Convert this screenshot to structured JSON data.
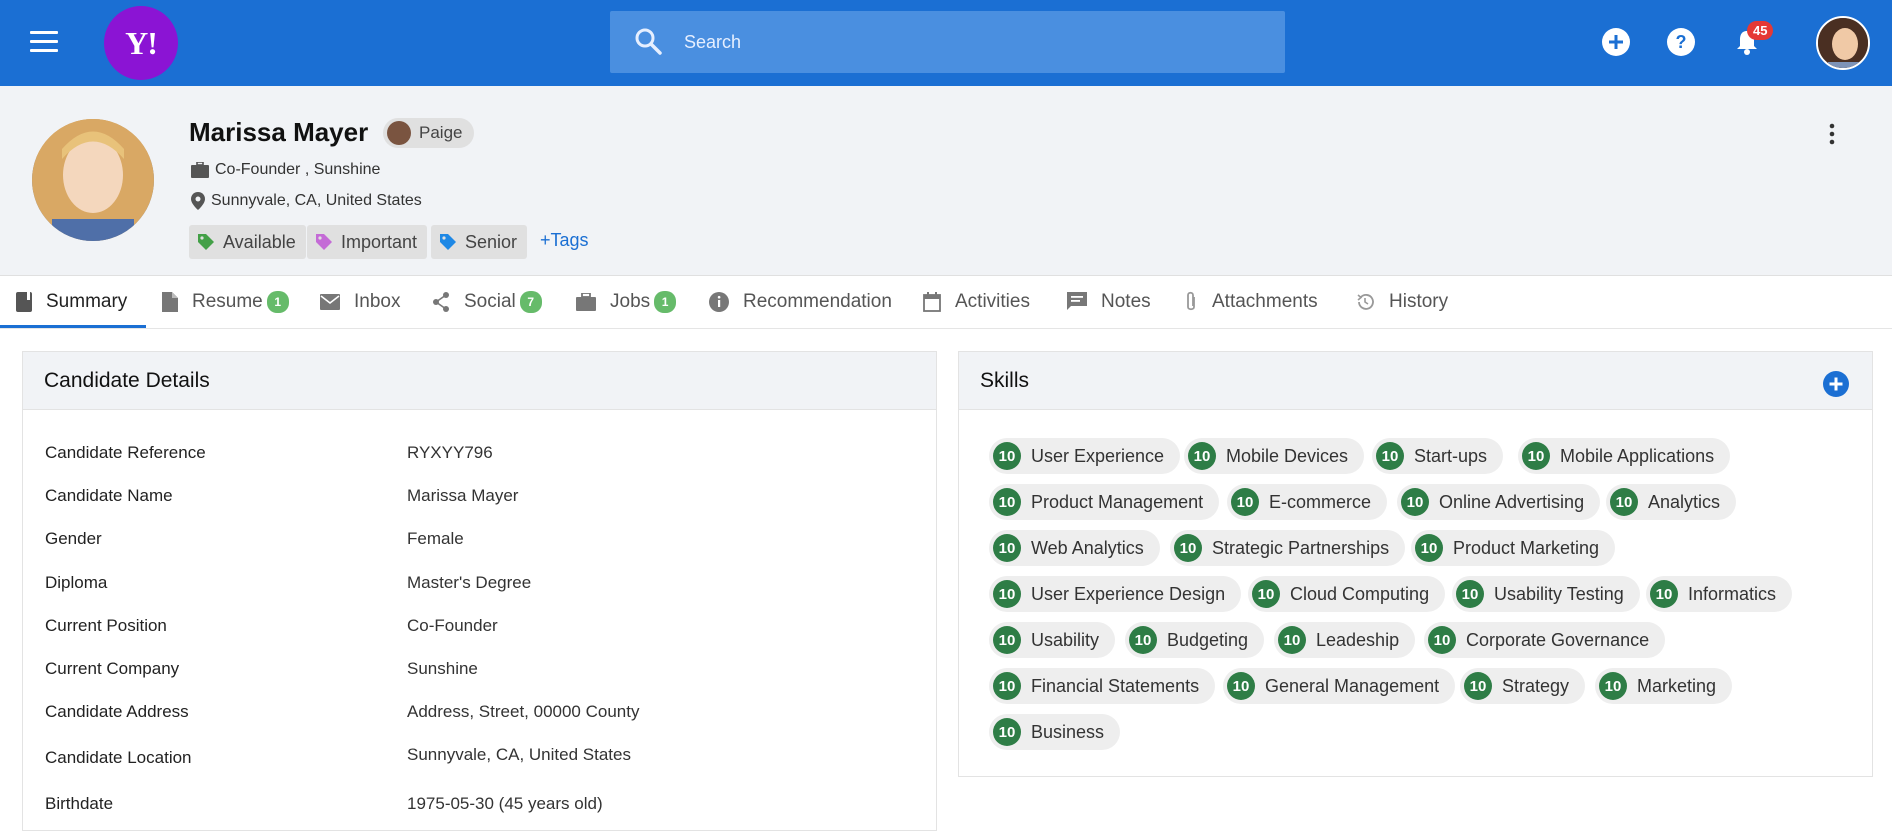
{
  "header": {
    "logo_text": "Y!",
    "search_placeholder": "Search",
    "notification_count": "45"
  },
  "profile": {
    "name": "Marissa Mayer",
    "owner": "Paige",
    "position_line": "Co-Founder , Sunshine",
    "location_line": "Sunnyvale, CA, United States",
    "tags": [
      {
        "label": "Available",
        "color": "#43a047"
      },
      {
        "label": "Important",
        "color": "#c46bd6"
      },
      {
        "label": "Senior",
        "color": "#1e88e5"
      }
    ],
    "add_tags_label": "+Tags"
  },
  "tabs": [
    {
      "label": "Summary",
      "icon": "book-icon"
    },
    {
      "label": "Resume",
      "icon": "document-icon",
      "count": "1"
    },
    {
      "label": "Inbox",
      "icon": "mail-icon"
    },
    {
      "label": "Social",
      "icon": "share-icon",
      "count": "7"
    },
    {
      "label": "Jobs",
      "icon": "briefcase-icon",
      "count": "1"
    },
    {
      "label": "Recommendation",
      "icon": "info-icon"
    },
    {
      "label": "Activities",
      "icon": "calendar-icon"
    },
    {
      "label": "Notes",
      "icon": "comment-icon"
    },
    {
      "label": "Attachments",
      "icon": "paperclip-icon"
    },
    {
      "label": "History",
      "icon": "history-icon"
    }
  ],
  "details": {
    "title": "Candidate Details",
    "rows": [
      {
        "label": "Candidate Reference",
        "value": "RYXYY796"
      },
      {
        "label": "Candidate Name",
        "value": "Marissa Mayer"
      },
      {
        "label": "Gender",
        "value": "Female"
      },
      {
        "label": "Diploma",
        "value": "Master's Degree"
      },
      {
        "label": "Current Position",
        "value": "Co-Founder"
      },
      {
        "label": "Current Company",
        "value": "Sunshine"
      },
      {
        "label": "Candidate Address",
        "value": "Address, Street, 00000 County"
      },
      {
        "label": "Candidate Location",
        "value": "Sunnyvale, CA, United States"
      },
      {
        "label": "Birthdate",
        "value": "1975-05-30 (45 years old)"
      }
    ]
  },
  "skills": {
    "title": "Skills",
    "items": [
      {
        "level": "10",
        "label": "User Experience"
      },
      {
        "level": "10",
        "label": "Mobile Devices"
      },
      {
        "level": "10",
        "label": "Start-ups"
      },
      {
        "level": "10",
        "label": "Mobile Applications"
      },
      {
        "level": "10",
        "label": "Product Management"
      },
      {
        "level": "10",
        "label": "E-commerce"
      },
      {
        "level": "10",
        "label": "Online Advertising"
      },
      {
        "level": "10",
        "label": "Analytics"
      },
      {
        "level": "10",
        "label": "Web Analytics"
      },
      {
        "level": "10",
        "label": "Strategic Partnerships"
      },
      {
        "level": "10",
        "label": "Product Marketing"
      },
      {
        "level": "10",
        "label": "User Experience Design"
      },
      {
        "level": "10",
        "label": "Cloud Computing"
      },
      {
        "level": "10",
        "label": "Usability Testing"
      },
      {
        "level": "10",
        "label": "Informatics"
      },
      {
        "level": "10",
        "label": "Usability"
      },
      {
        "level": "10",
        "label": "Budgeting"
      },
      {
        "level": "10",
        "label": "Leadeship"
      },
      {
        "level": "10",
        "label": "Corporate Governance"
      },
      {
        "level": "10",
        "label": "Financial Statements"
      },
      {
        "level": "10",
        "label": "General Management"
      },
      {
        "level": "10",
        "label": "Strategy"
      },
      {
        "level": "10",
        "label": "Marketing"
      },
      {
        "level": "10",
        "label": "Business"
      }
    ]
  }
}
